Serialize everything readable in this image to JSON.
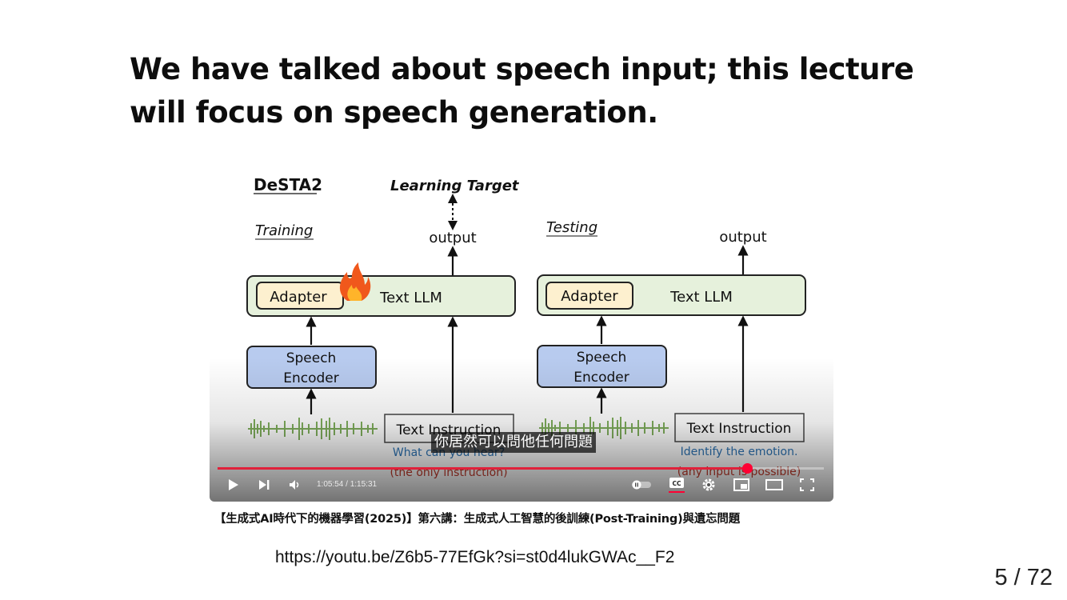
{
  "slide": {
    "title": "We have talked about speech input; this lecture will focus on speech generation.",
    "caption": "【生成式AI時代下的機器學習(2025)】第六講：生成式人工智慧的後訓練(Post-Training)與遺忘問題",
    "link": "https://youtu.be/Z6b5-77EfGk?si=st0d4lukGWAc__F2",
    "page_indicator": "5 / 72"
  },
  "diagram": {
    "model_name": "DeSTA2",
    "learning_target": "Learning Target",
    "left": {
      "section_label": "Training",
      "output_label": "output",
      "adapter_label": "Adapter",
      "llm_label": "Text LLM",
      "encoder_line1": "Speech",
      "encoder_line2": "Encoder",
      "instruction_label": "Text Instruction",
      "prompt_line1": "What can you hear?",
      "prompt_line2": "(the only instruction)",
      "fire_icon": "fire-icon"
    },
    "right": {
      "section_label": "Testing",
      "output_label": "output",
      "adapter_label": "Adapter",
      "llm_label": "Text LLM",
      "encoder_line1": "Speech",
      "encoder_line2": "Encoder",
      "instruction_label": "Text Instruction",
      "prompt_line1": "Identify the emotion.",
      "prompt_line2": "(any input is possible)"
    },
    "colors": {
      "llm_fill": "#e6f1dc",
      "adapter_fill": "#fdf0cf",
      "encoder_fill": "#b8cbef",
      "waveform": "#7fae5c",
      "prompt_blue": "#2e75b6",
      "prompt_red": "#c0392b"
    }
  },
  "player": {
    "subtitle": "你居然可以問他任何問題",
    "current_time": "1:05:54",
    "total_time": "1:15:31",
    "time_display": "1:05:54 / 1:15:31",
    "progress": 0.8727,
    "progress_color": "#ff0033",
    "controls": [
      "play-icon",
      "next-icon",
      "volume-icon",
      "autoplay-toggle-icon",
      "cc-icon",
      "settings-icon",
      "miniplayer-icon",
      "theater-icon",
      "fullscreen-icon"
    ]
  }
}
